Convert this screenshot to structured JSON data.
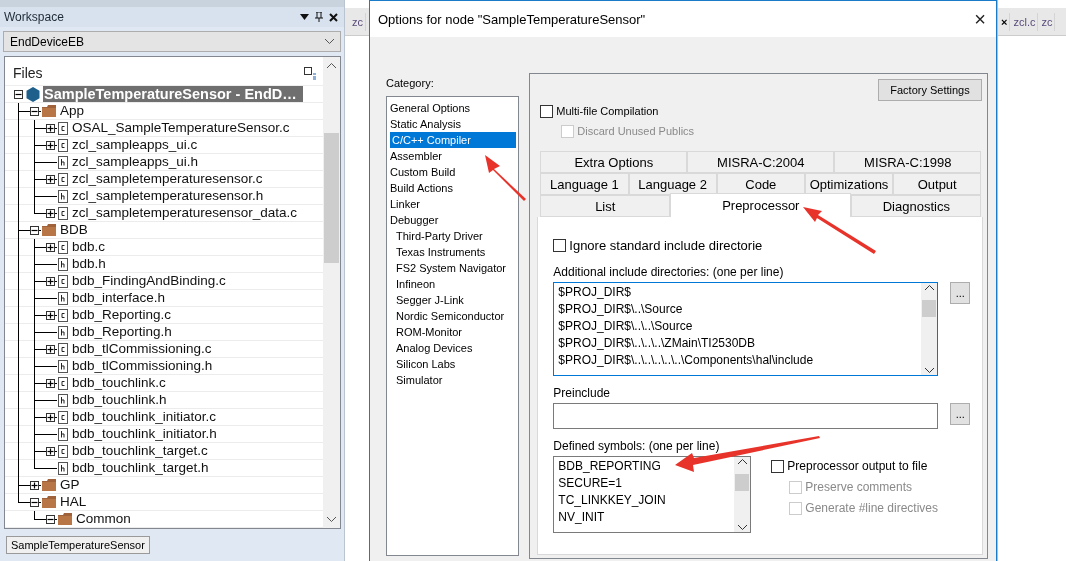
{
  "workspace": {
    "title": "Workspace",
    "configuration": "EndDeviceEB",
    "files_header": "Files",
    "tree": [
      {
        "label": "SampleTemperatureSensor - EndD…",
        "kind": "project",
        "expandable": true,
        "expanded": true,
        "selected": true,
        "children": [
          {
            "label": "App",
            "kind": "folder",
            "expandable": true,
            "expanded": true,
            "selected": false,
            "children": [
              {
                "label": "OSAL_SampleTemperatureSensor.c",
                "kind": "c-file",
                "expandable": true,
                "expanded": false,
                "selected": false
              },
              {
                "label": "zcl_sampleapps_ui.c",
                "kind": "c-file",
                "expandable": true,
                "expanded": false,
                "selected": false
              },
              {
                "label": "zcl_sampleapps_ui.h",
                "kind": "h-file",
                "expandable": false,
                "selected": false
              },
              {
                "label": "zcl_sampletemperaturesensor.c",
                "kind": "c-file",
                "expandable": true,
                "expanded": false,
                "selected": false
              },
              {
                "label": "zcl_sampletemperaturesensor.h",
                "kind": "h-file",
                "expandable": false,
                "selected": false
              },
              {
                "label": "zcl_sampletemperaturesensor_data.c",
                "kind": "c-file",
                "expandable": true,
                "expanded": false,
                "selected": false
              }
            ]
          },
          {
            "label": "BDB",
            "kind": "folder",
            "expandable": true,
            "expanded": true,
            "selected": false,
            "children": [
              {
                "label": "bdb.c",
                "kind": "c-file",
                "expandable": true,
                "expanded": false,
                "selected": false
              },
              {
                "label": "bdb.h",
                "kind": "h-file",
                "expandable": false,
                "selected": false
              },
              {
                "label": "bdb_FindingAndBinding.c",
                "kind": "c-file",
                "expandable": true,
                "expanded": false,
                "selected": false
              },
              {
                "label": "bdb_interface.h",
                "kind": "h-file",
                "expandable": false,
                "selected": false
              },
              {
                "label": "bdb_Reporting.c",
                "kind": "c-file",
                "expandable": true,
                "expanded": false,
                "selected": false
              },
              {
                "label": "bdb_Reporting.h",
                "kind": "h-file",
                "expandable": false,
                "selected": false
              },
              {
                "label": "bdb_tlCommissioning.c",
                "kind": "c-file",
                "expandable": true,
                "expanded": false,
                "selected": false
              },
              {
                "label": "bdb_tlCommissioning.h",
                "kind": "h-file",
                "expandable": false,
                "selected": false
              },
              {
                "label": "bdb_touchlink.c",
                "kind": "c-file",
                "expandable": true,
                "expanded": false,
                "selected": false
              },
              {
                "label": "bdb_touchlink.h",
                "kind": "h-file",
                "expandable": false,
                "selected": false
              },
              {
                "label": "bdb_touchlink_initiator.c",
                "kind": "c-file",
                "expandable": true,
                "expanded": false,
                "selected": false
              },
              {
                "label": "bdb_touchlink_initiator.h",
                "kind": "h-file",
                "expandable": false,
                "selected": false
              },
              {
                "label": "bdb_touchlink_target.c",
                "kind": "c-file",
                "expandable": true,
                "expanded": false,
                "selected": false
              },
              {
                "label": "bdb_touchlink_target.h",
                "kind": "h-file",
                "expandable": false,
                "selected": false
              }
            ]
          },
          {
            "label": "GP",
            "kind": "folder",
            "expandable": true,
            "expanded": false,
            "selected": false
          },
          {
            "label": "HAL",
            "kind": "folder",
            "expandable": true,
            "expanded": true,
            "selected": false,
            "children": [
              {
                "label": "Common",
                "kind": "folder",
                "expandable": true,
                "expanded": true,
                "selected": false
              }
            ]
          }
        ]
      }
    ],
    "bottom_tab": "SampleTemperatureSensor"
  },
  "editor_tabs_left": [
    "zc"
  ],
  "editor_tabs_right": [
    {
      "label": "×",
      "kind": "close"
    },
    {
      "label": "zcl.c",
      "kind": "tab"
    },
    {
      "label": "zc",
      "kind": "tab"
    }
  ],
  "dialog": {
    "title": "Options for node \"SampleTemperatureSensor\"",
    "close": "×",
    "category_label": "Category:",
    "categories": [
      {
        "label": "General Options",
        "selected": false
      },
      {
        "label": "Static Analysis",
        "selected": false
      },
      {
        "label": "C/C++ Compiler",
        "selected": true
      },
      {
        "label": "Assembler",
        "selected": false
      },
      {
        "label": "Custom Build",
        "selected": false
      },
      {
        "label": "Build Actions",
        "selected": false
      },
      {
        "label": "Linker",
        "selected": false
      },
      {
        "label": "Debugger",
        "selected": false,
        "children": [
          {
            "label": "Third-Party Driver",
            "selected": false
          },
          {
            "label": "Texas Instruments",
            "selected": false
          },
          {
            "label": "FS2 System Navigator",
            "selected": false
          },
          {
            "label": "Infineon",
            "selected": false
          },
          {
            "label": "Segger J-Link",
            "selected": false
          },
          {
            "label": "Nordic Semiconductor",
            "selected": false
          },
          {
            "label": "ROM-Monitor",
            "selected": false
          },
          {
            "label": "Analog Devices",
            "selected": false
          },
          {
            "label": "Silicon Labs",
            "selected": false
          },
          {
            "label": "Simulator",
            "selected": false
          }
        ]
      }
    ],
    "factory_settings": "Factory Settings",
    "multi_file": {
      "label": "Multi-file Compilation",
      "checked": false,
      "disabled": false
    },
    "discard_unused": {
      "label": "Discard Unused Publics",
      "checked": false,
      "disabled": true
    },
    "tab_rows": [
      {
        "tabs": [
          {
            "label": "Extra Options",
            "selected": false
          },
          {
            "label": "MISRA-C:2004",
            "selected": false
          },
          {
            "label": "MISRA-C:1998",
            "selected": false
          }
        ]
      },
      {
        "tabs": [
          {
            "label": "Language 1",
            "selected": false
          },
          {
            "label": "Language 2",
            "selected": false
          },
          {
            "label": "Code",
            "selected": false
          },
          {
            "label": "Optimizations",
            "selected": false
          },
          {
            "label": "Output",
            "selected": false
          }
        ]
      },
      {
        "tabs": [
          {
            "label": "List",
            "selected": false
          },
          {
            "label": "Preprocessor",
            "selected": true
          },
          {
            "label": "Diagnostics",
            "selected": false
          }
        ]
      }
    ],
    "ignore_std": {
      "label": "Ignore standard include directorie",
      "checked": false,
      "disabled": false
    },
    "include_label": "Additional include directories: (one per line)",
    "include_dirs": [
      "$PROJ_DIR$",
      "$PROJ_DIR$\\..\\Source",
      "$PROJ_DIR$\\..\\..\\Source",
      "$PROJ_DIR$\\..\\..\\..\\ZMain\\TI2530DB",
      "$PROJ_DIR$\\..\\..\\..\\..\\..\\Components\\hal\\include"
    ],
    "browse": "...",
    "preinclude_label": "Preinclude",
    "preinclude_browse": "...",
    "symbols_label": "Defined symbols: (one per line)",
    "symbols": [
      "BDB_REPORTING",
      "SECURE=1",
      "TC_LINKKEY_JOIN",
      "NV_INIT"
    ],
    "preprocessor_output": {
      "label": "Preprocessor output to file",
      "checked": false,
      "disabled": false
    },
    "preserve_comments": {
      "label": "Preserve comments",
      "checked": false,
      "disabled": true
    },
    "line_directives": {
      "label": "Generate #line directives",
      "checked": false,
      "disabled": true
    }
  }
}
